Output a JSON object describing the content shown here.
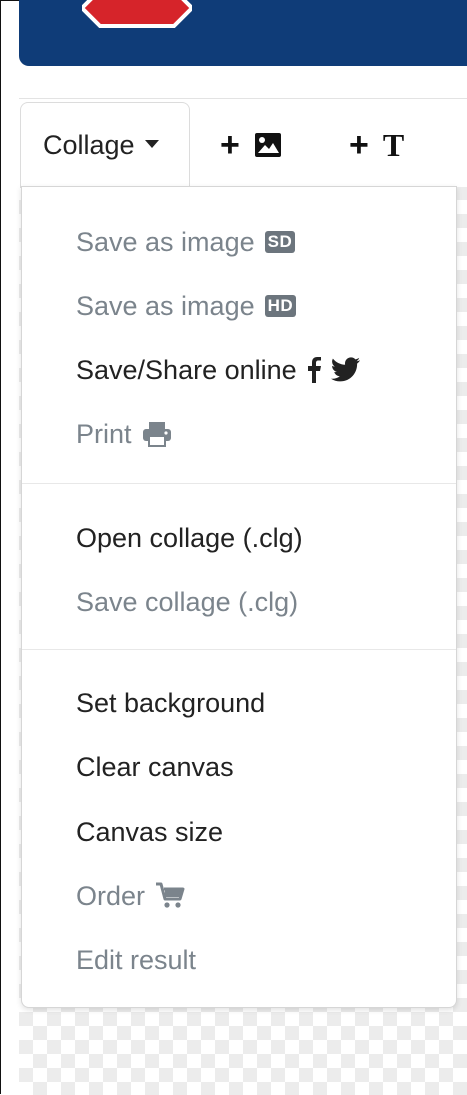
{
  "header": {
    "banner_color": "#0f3c78",
    "logo": "stop-sign-logo"
  },
  "toolbar": {
    "collage_label": "Collage",
    "add_image_plus": "+",
    "add_image_icon": "image-icon",
    "add_text_plus": "+",
    "add_text_glyph": "T"
  },
  "menu": {
    "save_sd": {
      "label": "Save as image",
      "badge": "SD",
      "enabled": false
    },
    "save_hd": {
      "label": "Save as image",
      "badge": "HD",
      "enabled": false
    },
    "share_online": {
      "label": "Save/Share online",
      "icons": [
        "facebook-icon",
        "twitter-icon"
      ],
      "enabled": true
    },
    "print": {
      "label": "Print",
      "icon": "print-icon",
      "enabled": false
    },
    "open_collage": {
      "label": "Open collage (.clg)",
      "enabled": true
    },
    "save_collage": {
      "label": "Save collage (.clg)",
      "enabled": false
    },
    "set_background": {
      "label": "Set background",
      "enabled": true
    },
    "clear_canvas": {
      "label": "Clear canvas",
      "enabled": true
    },
    "canvas_size": {
      "label": "Canvas size",
      "enabled": true
    },
    "order": {
      "label": "Order",
      "icon": "cart-icon",
      "enabled": false
    },
    "edit_result": {
      "label": "Edit result",
      "enabled": false
    }
  },
  "colors": {
    "enabled_text": "#222222",
    "disabled_text": "#7b848c",
    "badge": "#6c757d"
  }
}
